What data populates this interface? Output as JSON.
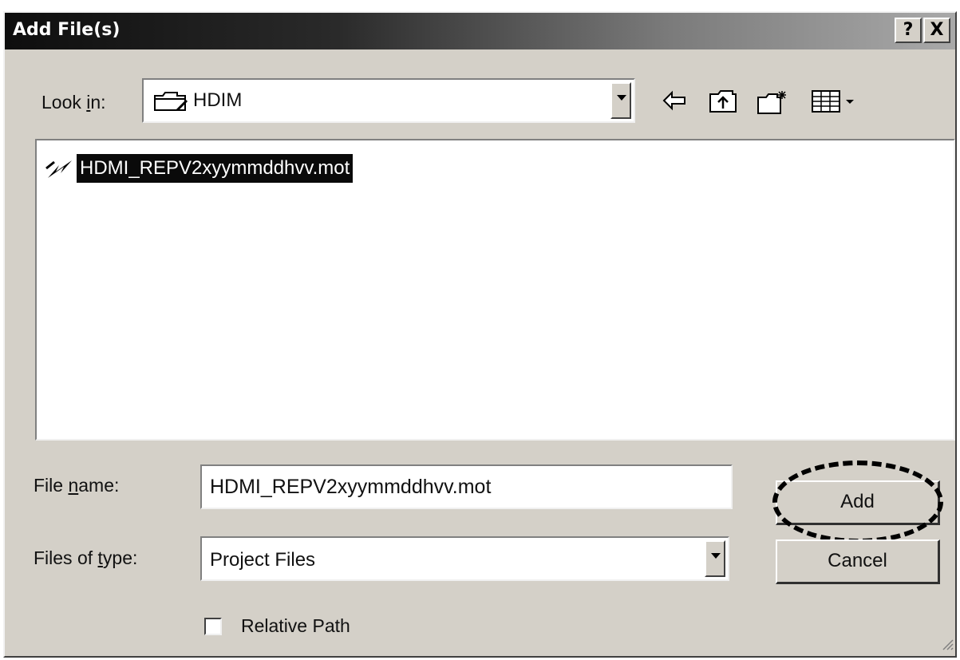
{
  "window": {
    "title": "Add File(s)",
    "help_button": "?",
    "close_button": "X"
  },
  "look_in": {
    "label_prefix": "Look ",
    "label_access": "i",
    "label_suffix": "n:",
    "value": "HDIM"
  },
  "toolbar": {
    "icons": [
      "back-icon",
      "up-folder-icon",
      "new-folder-icon",
      "view-menu-icon"
    ]
  },
  "file_list": {
    "items": [
      {
        "name": "HDMI_REPV2xyymmddhvv.mot",
        "selected": true,
        "icon": "mot-file-icon"
      }
    ]
  },
  "file_name": {
    "label_prefix": "File ",
    "label_access": "n",
    "label_suffix": "ame:",
    "value": "HDMI_REPV2xyymmddhvv.mot"
  },
  "file_type": {
    "label_prefix": "Files of ",
    "label_access": "t",
    "label_suffix": "ype:",
    "value": "Project Files"
  },
  "buttons": {
    "add": "Add",
    "cancel": "Cancel"
  },
  "relative_path": {
    "label": "Relative Path",
    "checked": false
  },
  "colors": {
    "dialog_face": "#d4d0c8",
    "selection": "#0a0a0a",
    "highlight_ring": "#000000"
  }
}
